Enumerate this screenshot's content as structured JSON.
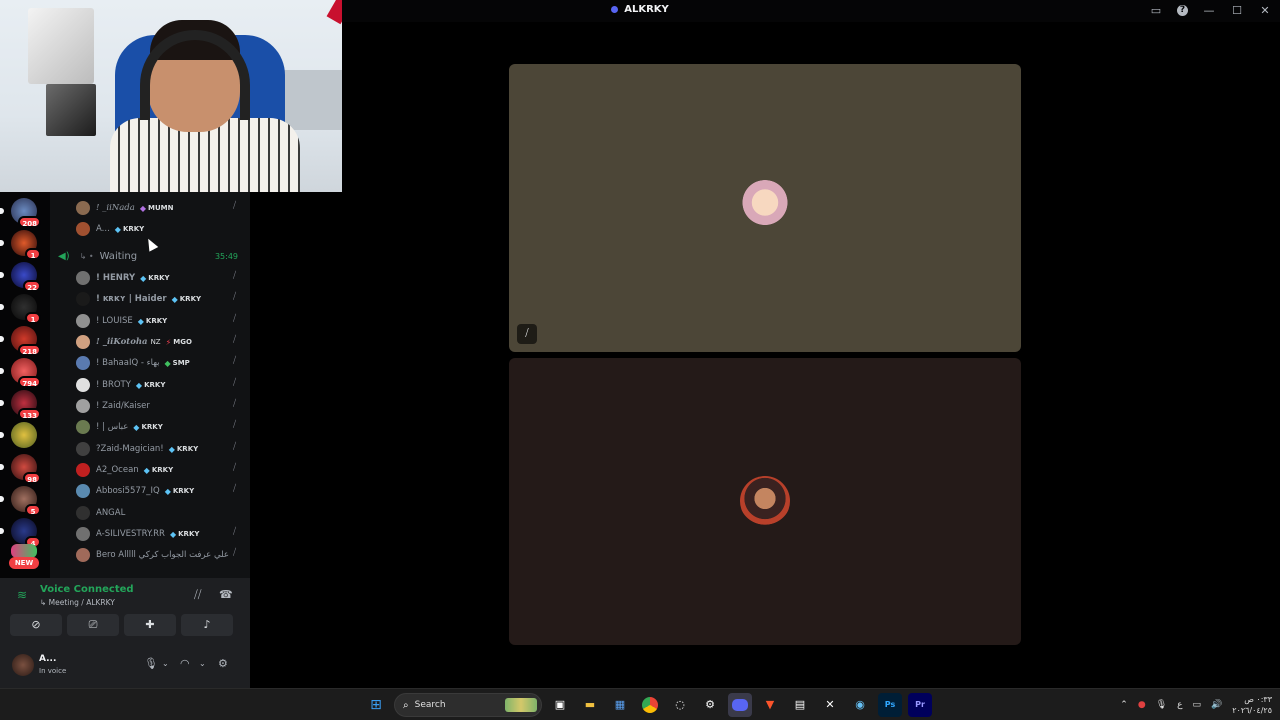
{
  "window": {
    "title": "ALKRKY",
    "controls": [
      "cast-icon",
      "help-icon",
      "minimize",
      "maximize",
      "close"
    ]
  },
  "servers": [
    {
      "badge": "208"
    },
    {
      "badge": "1"
    },
    {
      "badge": "22"
    },
    {
      "badge": "1"
    },
    {
      "badge": "218"
    },
    {
      "badge": "794"
    },
    {
      "badge": "133"
    },
    {
      "badge": ""
    },
    {
      "badge": "98"
    },
    {
      "badge": "5"
    },
    {
      "badge": "4"
    }
  ],
  "servers_new_label": "NEW",
  "channel": {
    "top_members": [
      {
        "name": "! _iiNada",
        "tag": "MUMN"
      },
      {
        "name": "A...",
        "tag": "KRKY"
      }
    ],
    "waiting": {
      "name": "Waiting",
      "time": "35:49"
    },
    "members": [
      {
        "name": "! HENRY",
        "tag": "KRKY"
      },
      {
        "name": "! ᴋʀᴋʏ | Haider",
        "tag": "KRKY"
      },
      {
        "name": "! LOUISE",
        "tag": "KRKY"
      },
      {
        "name": "! _iiKotoha",
        "sub": "NZ",
        "tag": "MGO"
      },
      {
        "name": "! BahaaIQ - بهاء",
        "tag": "SMP"
      },
      {
        "name": "! BROTY",
        "tag": "KRKY"
      },
      {
        "name": "! Zaid/Kaiser",
        "tag": ""
      },
      {
        "name": "! | عباس",
        "tag": "KRKY"
      },
      {
        "name": "?Zaid-Magician!",
        "tag": "KRKY"
      },
      {
        "name": "A2_Ocean",
        "tag": "KRKY"
      },
      {
        "name": "Abbosi5577_IQ",
        "tag": "KRKY"
      },
      {
        "name": "ANGAL",
        "tag": ""
      },
      {
        "name": "A-SILIVESTRY.RR",
        "tag": "KRKY"
      },
      {
        "name": "Bero Alllll علي عرفت الجواب كركي",
        "tag": ""
      }
    ]
  },
  "voice": {
    "status": "Voice Connected",
    "location": "Meeting / ALKRKY"
  },
  "user": {
    "name": "A...",
    "status": "In voice"
  },
  "taskbar": {
    "search_placeholder": "Search",
    "clock_time": "٠:٣٣ ص",
    "clock_date": "٢٠٢٦/٠٤/٢٥",
    "lang": "ع"
  }
}
